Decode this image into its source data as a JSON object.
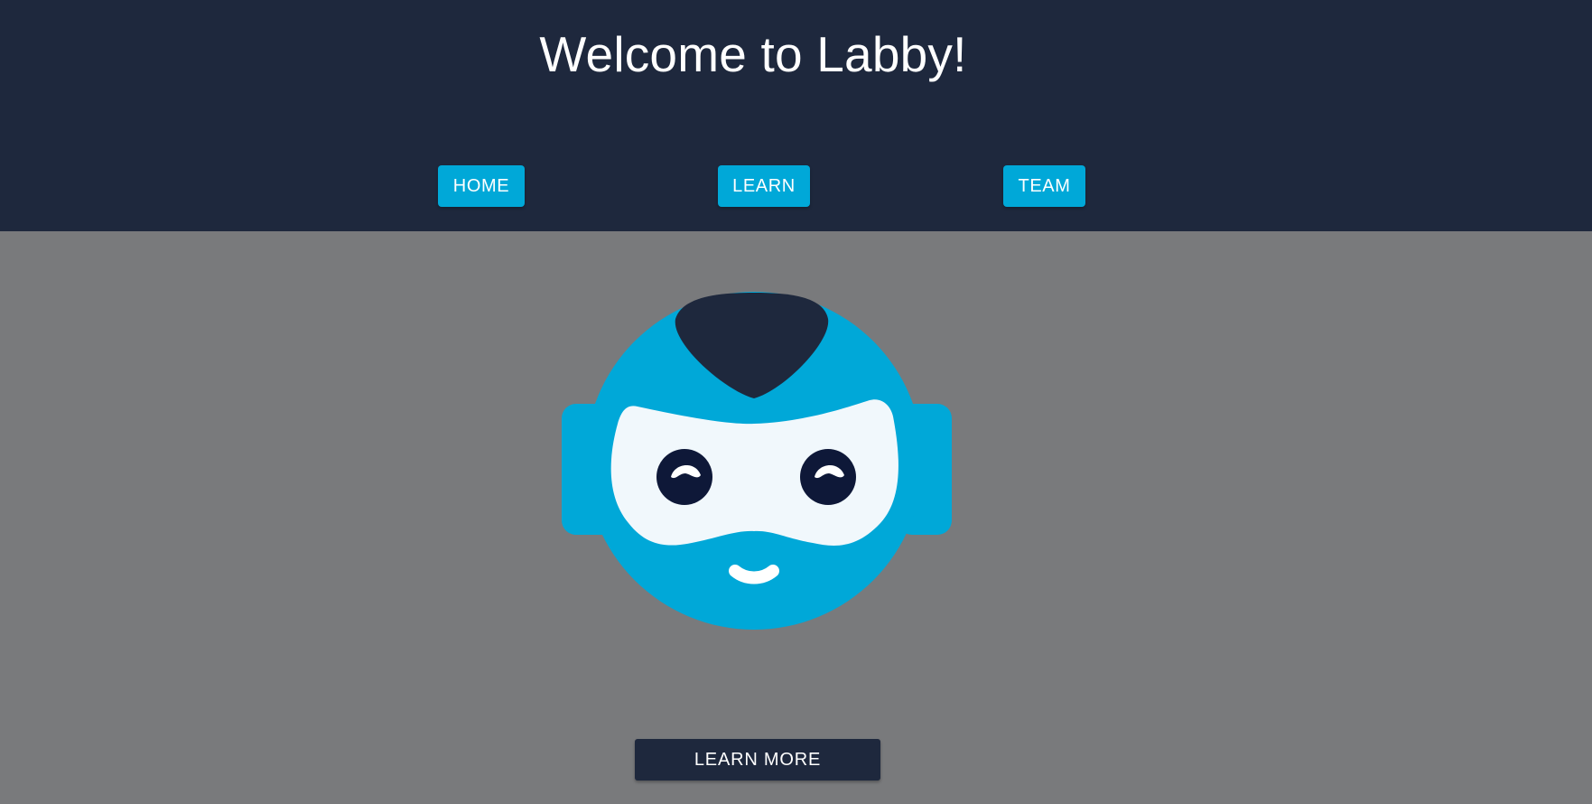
{
  "header": {
    "title": "Welcome to Labby!",
    "nav": [
      {
        "label": "HOME"
      },
      {
        "label": "LEARN"
      },
      {
        "label": "TEAM"
      }
    ]
  },
  "main": {
    "logo_icon": "robot-mascot-icon",
    "learn_more_label": "LEARN MORE"
  },
  "colors": {
    "header_bg": "#1e283d",
    "page_bg": "#797a7c",
    "accent": "#00a8d8",
    "visor": "#f1f8fc",
    "eyes": "#0e1838"
  }
}
